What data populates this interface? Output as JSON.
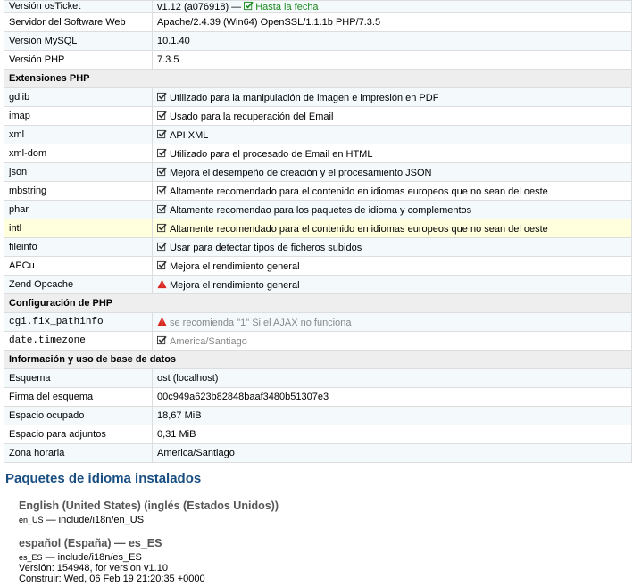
{
  "rows": [
    {
      "type": "data",
      "cls": "odd first",
      "key": "Versión osTicket",
      "value": "v1.12 (a076918) —",
      "status": "Hasta la fecha",
      "status_icon": "check-icon"
    },
    {
      "type": "data",
      "cls": "even",
      "key": "Servidor del Software Web",
      "value": "Apache/2.4.39 (Win64) OpenSSL/1.1.1b PHP/7.3.5"
    },
    {
      "type": "data",
      "cls": "odd",
      "key": "Versión MySQL",
      "value": "10.1.40"
    },
    {
      "type": "data",
      "cls": "even",
      "key": "Versión PHP",
      "value": "7.3.5"
    },
    {
      "type": "section",
      "label": "Extensiones PHP"
    },
    {
      "type": "data",
      "cls": "odd",
      "key": "gdlib",
      "icon": "check",
      "value": "Utilizado para la manipulación de imagen e impresión en PDF"
    },
    {
      "type": "data",
      "cls": "even",
      "key": "imap",
      "icon": "check",
      "value": "Usado para la recuperación del Email"
    },
    {
      "type": "data",
      "cls": "odd",
      "key": "xml",
      "icon": "check",
      "value": "API XML"
    },
    {
      "type": "data",
      "cls": "even",
      "key": "xml-dom",
      "icon": "check",
      "value": "Utilizado para el procesado de Email en HTML"
    },
    {
      "type": "data",
      "cls": "odd",
      "key": "json",
      "icon": "check",
      "value": "Mejora el desempeño de creación y el procesamiento JSON"
    },
    {
      "type": "data",
      "cls": "even",
      "key": "mbstring",
      "icon": "check",
      "value": "Altamente recomendado para el contenido en idiomas europeos que no sean del oeste"
    },
    {
      "type": "data",
      "cls": "odd",
      "key": "phar",
      "icon": "check",
      "value": "Altamente recomendao para los paquetes de idioma y complementos"
    },
    {
      "type": "data",
      "cls": "hl",
      "key": "intl",
      "icon": "check",
      "value": "Altamente recomendado para el contenido en idiomas europeos que no sean del oeste"
    },
    {
      "type": "data",
      "cls": "odd",
      "key": "fileinfo",
      "icon": "check",
      "value": "Usar para detectar tipos de ficheros subidos"
    },
    {
      "type": "data",
      "cls": "even",
      "key": "APCu",
      "icon": "check",
      "value": "Mejora el rendimiento general"
    },
    {
      "type": "data",
      "cls": "odd",
      "key": "Zend Opcache",
      "icon": "warning",
      "value": "Mejora el rendimiento general"
    },
    {
      "type": "section",
      "label": "Configuración de PHP"
    },
    {
      "type": "data",
      "cls": "odd",
      "key": "cgi.fix_pathinfo",
      "mono": true,
      "dim": true,
      "icon": "warning",
      "value": "se recomienda \"1\" Si el AJAX no funciona"
    },
    {
      "type": "data",
      "cls": "even",
      "key": "date.timezone",
      "mono": true,
      "dim": true,
      "icon": "check",
      "value": "America/Santiago"
    },
    {
      "type": "section",
      "label": "Información y uso de base de datos"
    },
    {
      "type": "data",
      "cls": "odd",
      "key": "Esquema",
      "value": "ost (localhost)"
    },
    {
      "type": "data",
      "cls": "even",
      "key": "Firma del esquema",
      "value": "00c949a623b82848baaf3480b51307e3"
    },
    {
      "type": "data",
      "cls": "odd",
      "key": "Espacio ocupado",
      "value": "18,67 MiB"
    },
    {
      "type": "data",
      "cls": "even",
      "key": "Espacio para adjuntos",
      "value": "0,31 MiB"
    },
    {
      "type": "data",
      "cls": "odd",
      "key": "Zona horaria",
      "value": "America/Santiago"
    }
  ],
  "lang_heading": "Paquetes de idioma instalados",
  "lang_packs": [
    {
      "title": "English (United States) (inglés (Estados Unidos))",
      "code": "en_US",
      "path": " — include/i18n/en_US",
      "lines": []
    },
    {
      "title": "español (España) — es_ES",
      "code": "es_ES",
      "path": " — include/i18n/es_ES",
      "lines": [
        "Versión: 154948, for version v1.10",
        "Construir: Wed, 06 Feb 19 21:20:35 +0000"
      ]
    }
  ],
  "colors": {
    "check": "#333333",
    "warning": "#d9251d",
    "ok": "#1c8a1c",
    "heading": "#184e81"
  }
}
